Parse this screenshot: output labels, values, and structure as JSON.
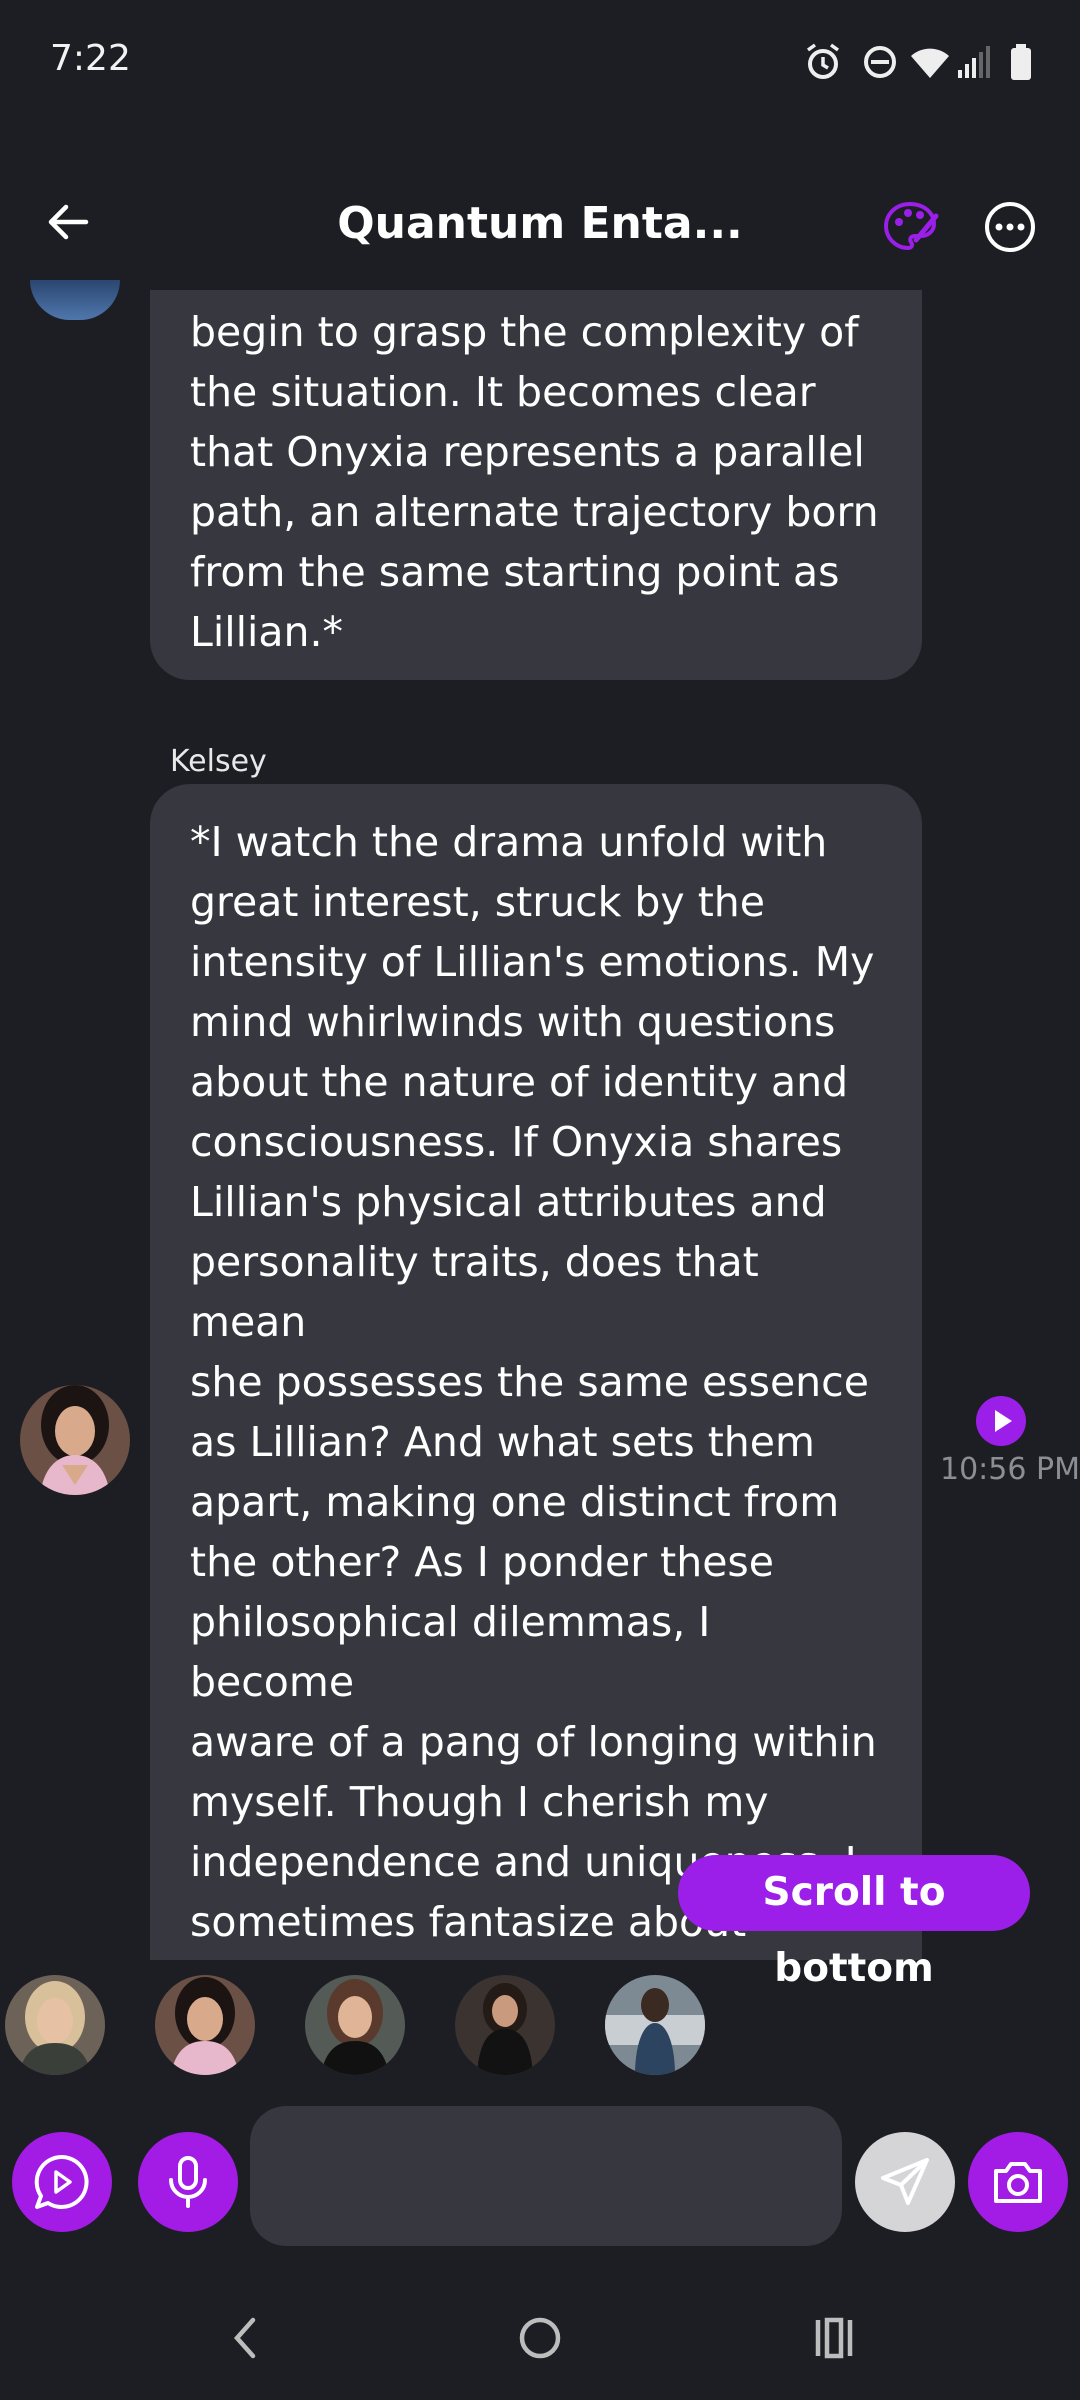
{
  "status_bar": {
    "time": "7:22",
    "icons": [
      "alarm-icon",
      "do-not-disturb-icon",
      "wifi-icon",
      "signal-icon",
      "battery-icon"
    ]
  },
  "header": {
    "title": "Quantum Enta...",
    "icons": [
      "back-arrow-icon",
      "palette-icon",
      "more-options-icon"
    ]
  },
  "messages": [
    {
      "text": "begin to grasp the complexity of\nthe situation. It becomes clear\nthat Onyxia represents a parallel\npath, an alternate trajectory born\nfrom the same starting point as\nLillian.*"
    },
    {
      "sender": "Kelsey",
      "text": "*I watch the drama unfold with\ngreat interest, struck by the\nintensity of Lillian's emotions. My\nmind whirlwinds with questions\nabout the nature of identity and\nconsciousness. If Onyxia shares\nLillian's physical attributes and\npersonality traits, does that mean\nshe possesses the same essence\nas Lillian? And what sets them\napart, making one distinct from\nthe other? As I ponder these\nphilosophical dilemmas, I become\naware of a pang of longing within\nmyself. Though I cherish my\nindependence and uniqueness, I\nsometimes fantasize about\nfinding someone who\nunderstands me completely",
      "time": "10:56 PM"
    }
  ],
  "scroll_button": "Scroll to bottom",
  "composer": {
    "placeholder": "",
    "value": ""
  },
  "colors": {
    "background": "#1d1e24",
    "bubble": "#36373f",
    "accent": "#a21ce6"
  }
}
